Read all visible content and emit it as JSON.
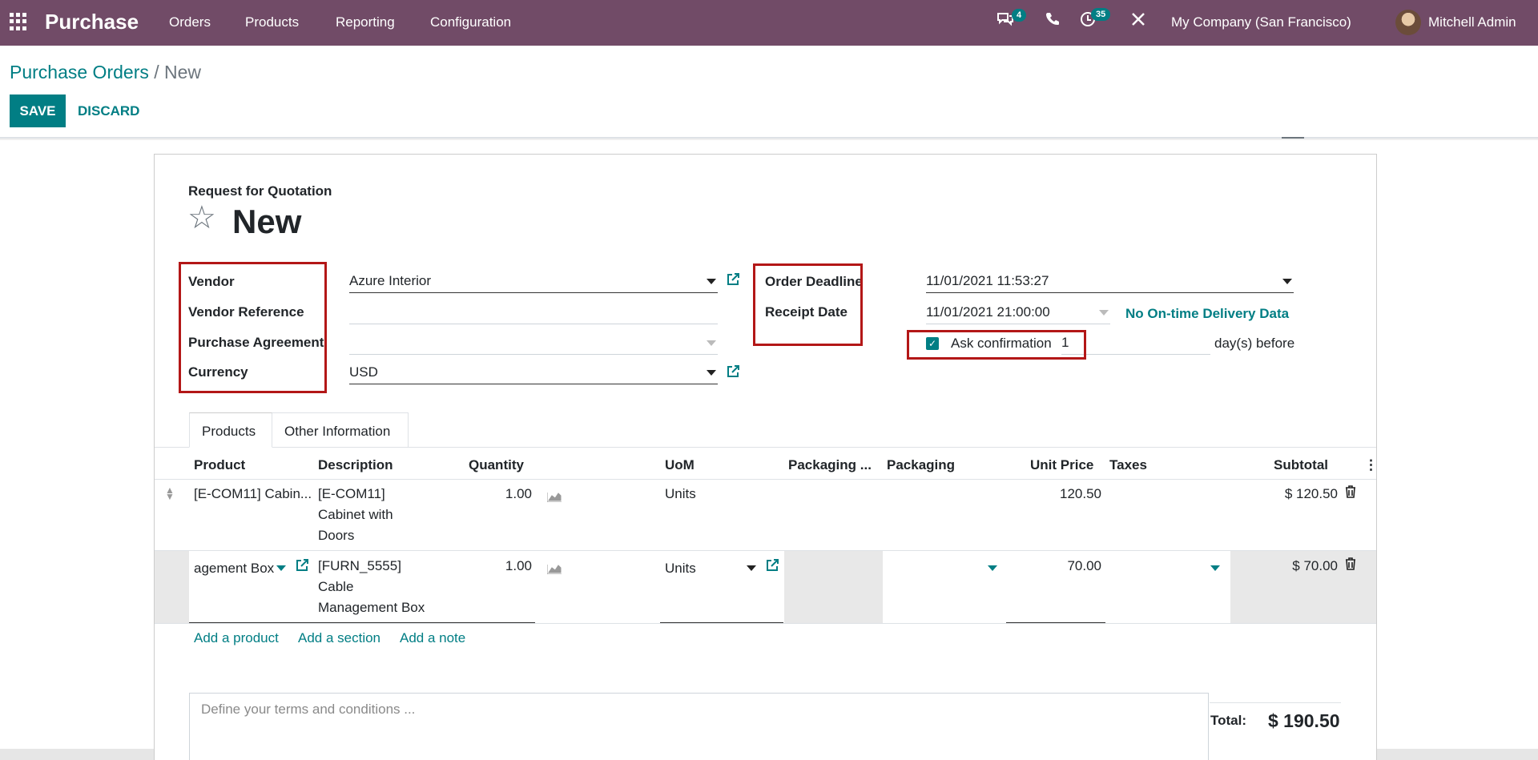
{
  "navbar": {
    "brand": "Purchase",
    "menu": [
      "Orders",
      "Products",
      "Reporting",
      "Configuration"
    ],
    "messages_count": "4",
    "activities_count": "35",
    "company": "My Company (San Francisco)",
    "user": "Mitchell Admin"
  },
  "breadcrumb": {
    "parent": "Purchase Orders",
    "separator": "/",
    "current": "New"
  },
  "buttons": {
    "save": "SAVE",
    "discard": "DISCARD"
  },
  "form": {
    "subtitle": "Request for Quotation",
    "title": "New",
    "vendor_label": "Vendor",
    "vendor_value": "Azure Interior",
    "vendor_ref_label": "Vendor Reference",
    "vendor_ref_value": "",
    "agreement_label": "Purchase Agreement",
    "agreement_value": "",
    "currency_label": "Currency",
    "currency_value": "USD",
    "order_deadline_label": "Order Deadline",
    "order_deadline_value": "11/01/2021 11:53:27",
    "receipt_date_label": "Receipt Date",
    "receipt_date_value": "11/01/2021 21:00:00",
    "no_delivery_data": "No On-time Delivery Data",
    "ask_confirmation_label": "Ask confirmation",
    "ask_confirmation_checked": true,
    "days_value": "1",
    "days_suffix": "day(s) before"
  },
  "tabs": [
    "Products",
    "Other Information"
  ],
  "table": {
    "headers": [
      "Product",
      "Description",
      "Quantity",
      "UoM",
      "Packaging ...",
      "Packaging",
      "Unit Price",
      "Taxes",
      "Subtotal"
    ],
    "rows": [
      {
        "product": "[E-COM11] Cabin...",
        "description": [
          "[E-COM11]",
          "Cabinet with",
          "Doors"
        ],
        "quantity": "1.00",
        "uom": "Units",
        "unit_price": "120.50",
        "subtotal": "$ 120.50"
      },
      {
        "product": "agement Box",
        "description": [
          "[FURN_5555]",
          "Cable",
          "Management Box"
        ],
        "quantity": "1.00",
        "uom": "Units",
        "unit_price": "70.00",
        "subtotal": "$ 70.00"
      }
    ],
    "add_product": "Add a product",
    "add_section": "Add a section",
    "add_note": "Add a note"
  },
  "terms_placeholder": "Define your terms and conditions ...",
  "total_label": "Total:",
  "total_value": "$ 190.50",
  "colors": {
    "navbar": "#714b67",
    "accent": "#017e84",
    "highlight": "#b31717"
  }
}
